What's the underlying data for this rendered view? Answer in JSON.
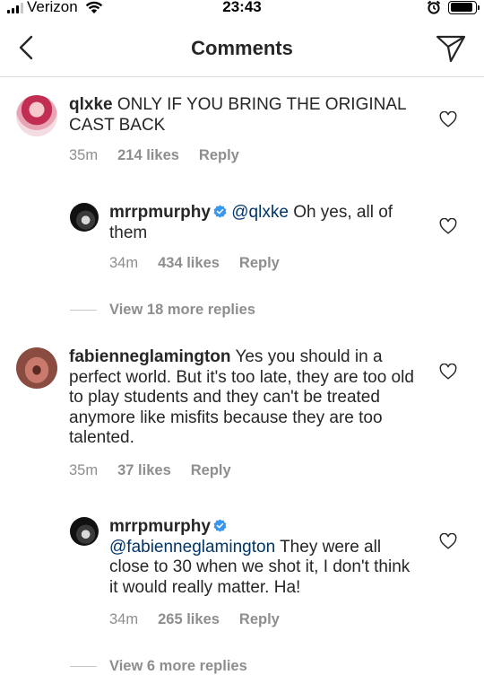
{
  "status_bar": {
    "carrier": "Verizon",
    "time": "23:43",
    "battery_level": 0.92
  },
  "nav": {
    "title": "Comments",
    "back_icon": "chevron-left-icon",
    "send_icon": "paper-plane-icon"
  },
  "comments": [
    {
      "username": "qlxke",
      "text": "ONLY IF YOU BRING THE ORIGINAL CAST BACK",
      "time": "35m",
      "likes": "214 likes",
      "reply": "Reply",
      "reply_to": {
        "username": "mrrpmurphy",
        "verified": true,
        "mention": "@qlxke",
        "text": "Oh yes, all of them",
        "time": "34m",
        "likes": "434 likes",
        "reply": "Reply"
      },
      "view_more": "View 18 more replies"
    },
    {
      "username": "fabienneglamington",
      "text": "Yes you should in a perfect world. But it's too late, they are too old to play students and they can't be treated anymore like misfits because they are too talented.",
      "time": "35m",
      "likes": "37 likes",
      "reply": "Reply",
      "reply_to": {
        "username": "mrrpmurphy",
        "verified": true,
        "mention": "@fabienneglamington",
        "text": "They were all close to 30 when we shot it, I don't think it would really matter. Ha!",
        "time": "34m",
        "likes": "265 likes",
        "reply": "Reply"
      },
      "view_more": "View 6 more replies"
    }
  ],
  "colors": {
    "text": "#262626",
    "secondary": "#8e8e8e",
    "mention": "#003569",
    "verified": "#3897f0",
    "divider": "#dbdbdb"
  }
}
